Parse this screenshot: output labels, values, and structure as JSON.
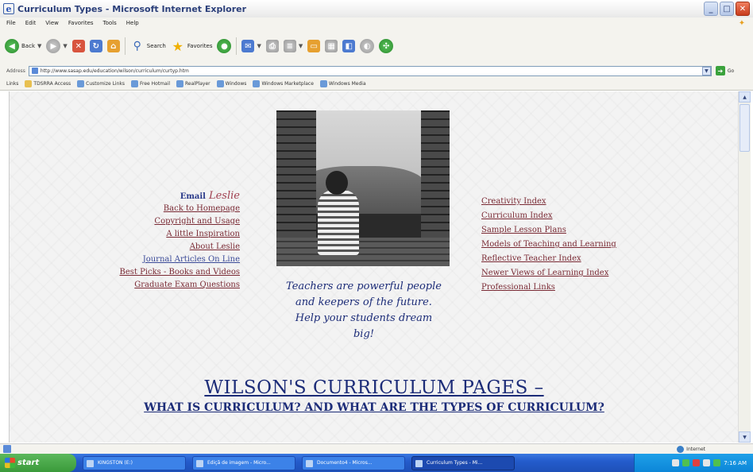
{
  "window": {
    "title": "Curriculum Types - Microsoft Internet Explorer",
    "minimize": "_",
    "maximize": "□",
    "close": "✕"
  },
  "menu": [
    "File",
    "Edit",
    "View",
    "Favorites",
    "Tools",
    "Help"
  ],
  "toolbar": {
    "back_label": "Back",
    "search_label": "Search",
    "favorites_label": "Favorites"
  },
  "address": {
    "label": "Address",
    "url": "http://www.sasap.edu/education/wilson/curriculum/curtyp.htm",
    "go_label": "Go"
  },
  "links_bar": {
    "label": "Links",
    "items": [
      "TDSRRA Access",
      "Customize Links",
      "Free Hotmail",
      "RealPlayer",
      "Windows",
      "Windows Marketplace",
      "Windows Media"
    ]
  },
  "page": {
    "email_label": "Email",
    "email_name": "Leslie",
    "left_links": [
      {
        "label": "Back to Homepage",
        "color": "#7a2a34"
      },
      {
        "label": "Copyright and Usage",
        "color": "#7a2a34"
      },
      {
        "label": "A little Inspiration",
        "color": "#7a2a34"
      },
      {
        "label": "About Leslie",
        "color": "#7a2a34"
      },
      {
        "label": "Journal Articles On Line",
        "color": "#3a4a98"
      },
      {
        "label": "Best Picks - Books and Videos",
        "color": "#7a2a34"
      },
      {
        "label": "Graduate Exam Questions",
        "color": "#7a2a34"
      }
    ],
    "right_links": [
      "Creativity Index",
      "Curriculum Index",
      "Sample Lesson Plans",
      "Models of Teaching and Learning",
      "Reflective Teacher Index",
      "Newer Views of Learning Index",
      "Professional Links"
    ],
    "quote": [
      "Teachers are powerful people",
      "and keepers of the future.",
      "Help your students dream",
      "big!"
    ],
    "heading1": "WILSON'S CURRICULUM PAGES –",
    "heading2": "WHAT IS CURRICULUM? AND WHAT ARE THE TYPES OF CURRICULUM?"
  },
  "status": {
    "zone": "Internet"
  },
  "taskbar": {
    "start_label": "start",
    "tasks": [
      {
        "label": "KINGSTON (E:)",
        "active": false
      },
      {
        "label": "Ediçã de imagem - Micro...",
        "active": false
      },
      {
        "label": "Documento4 - Micros...",
        "active": false
      },
      {
        "label": "Curriculum Types - Mi...",
        "active": true
      }
    ],
    "clock": "7:16 AM"
  }
}
